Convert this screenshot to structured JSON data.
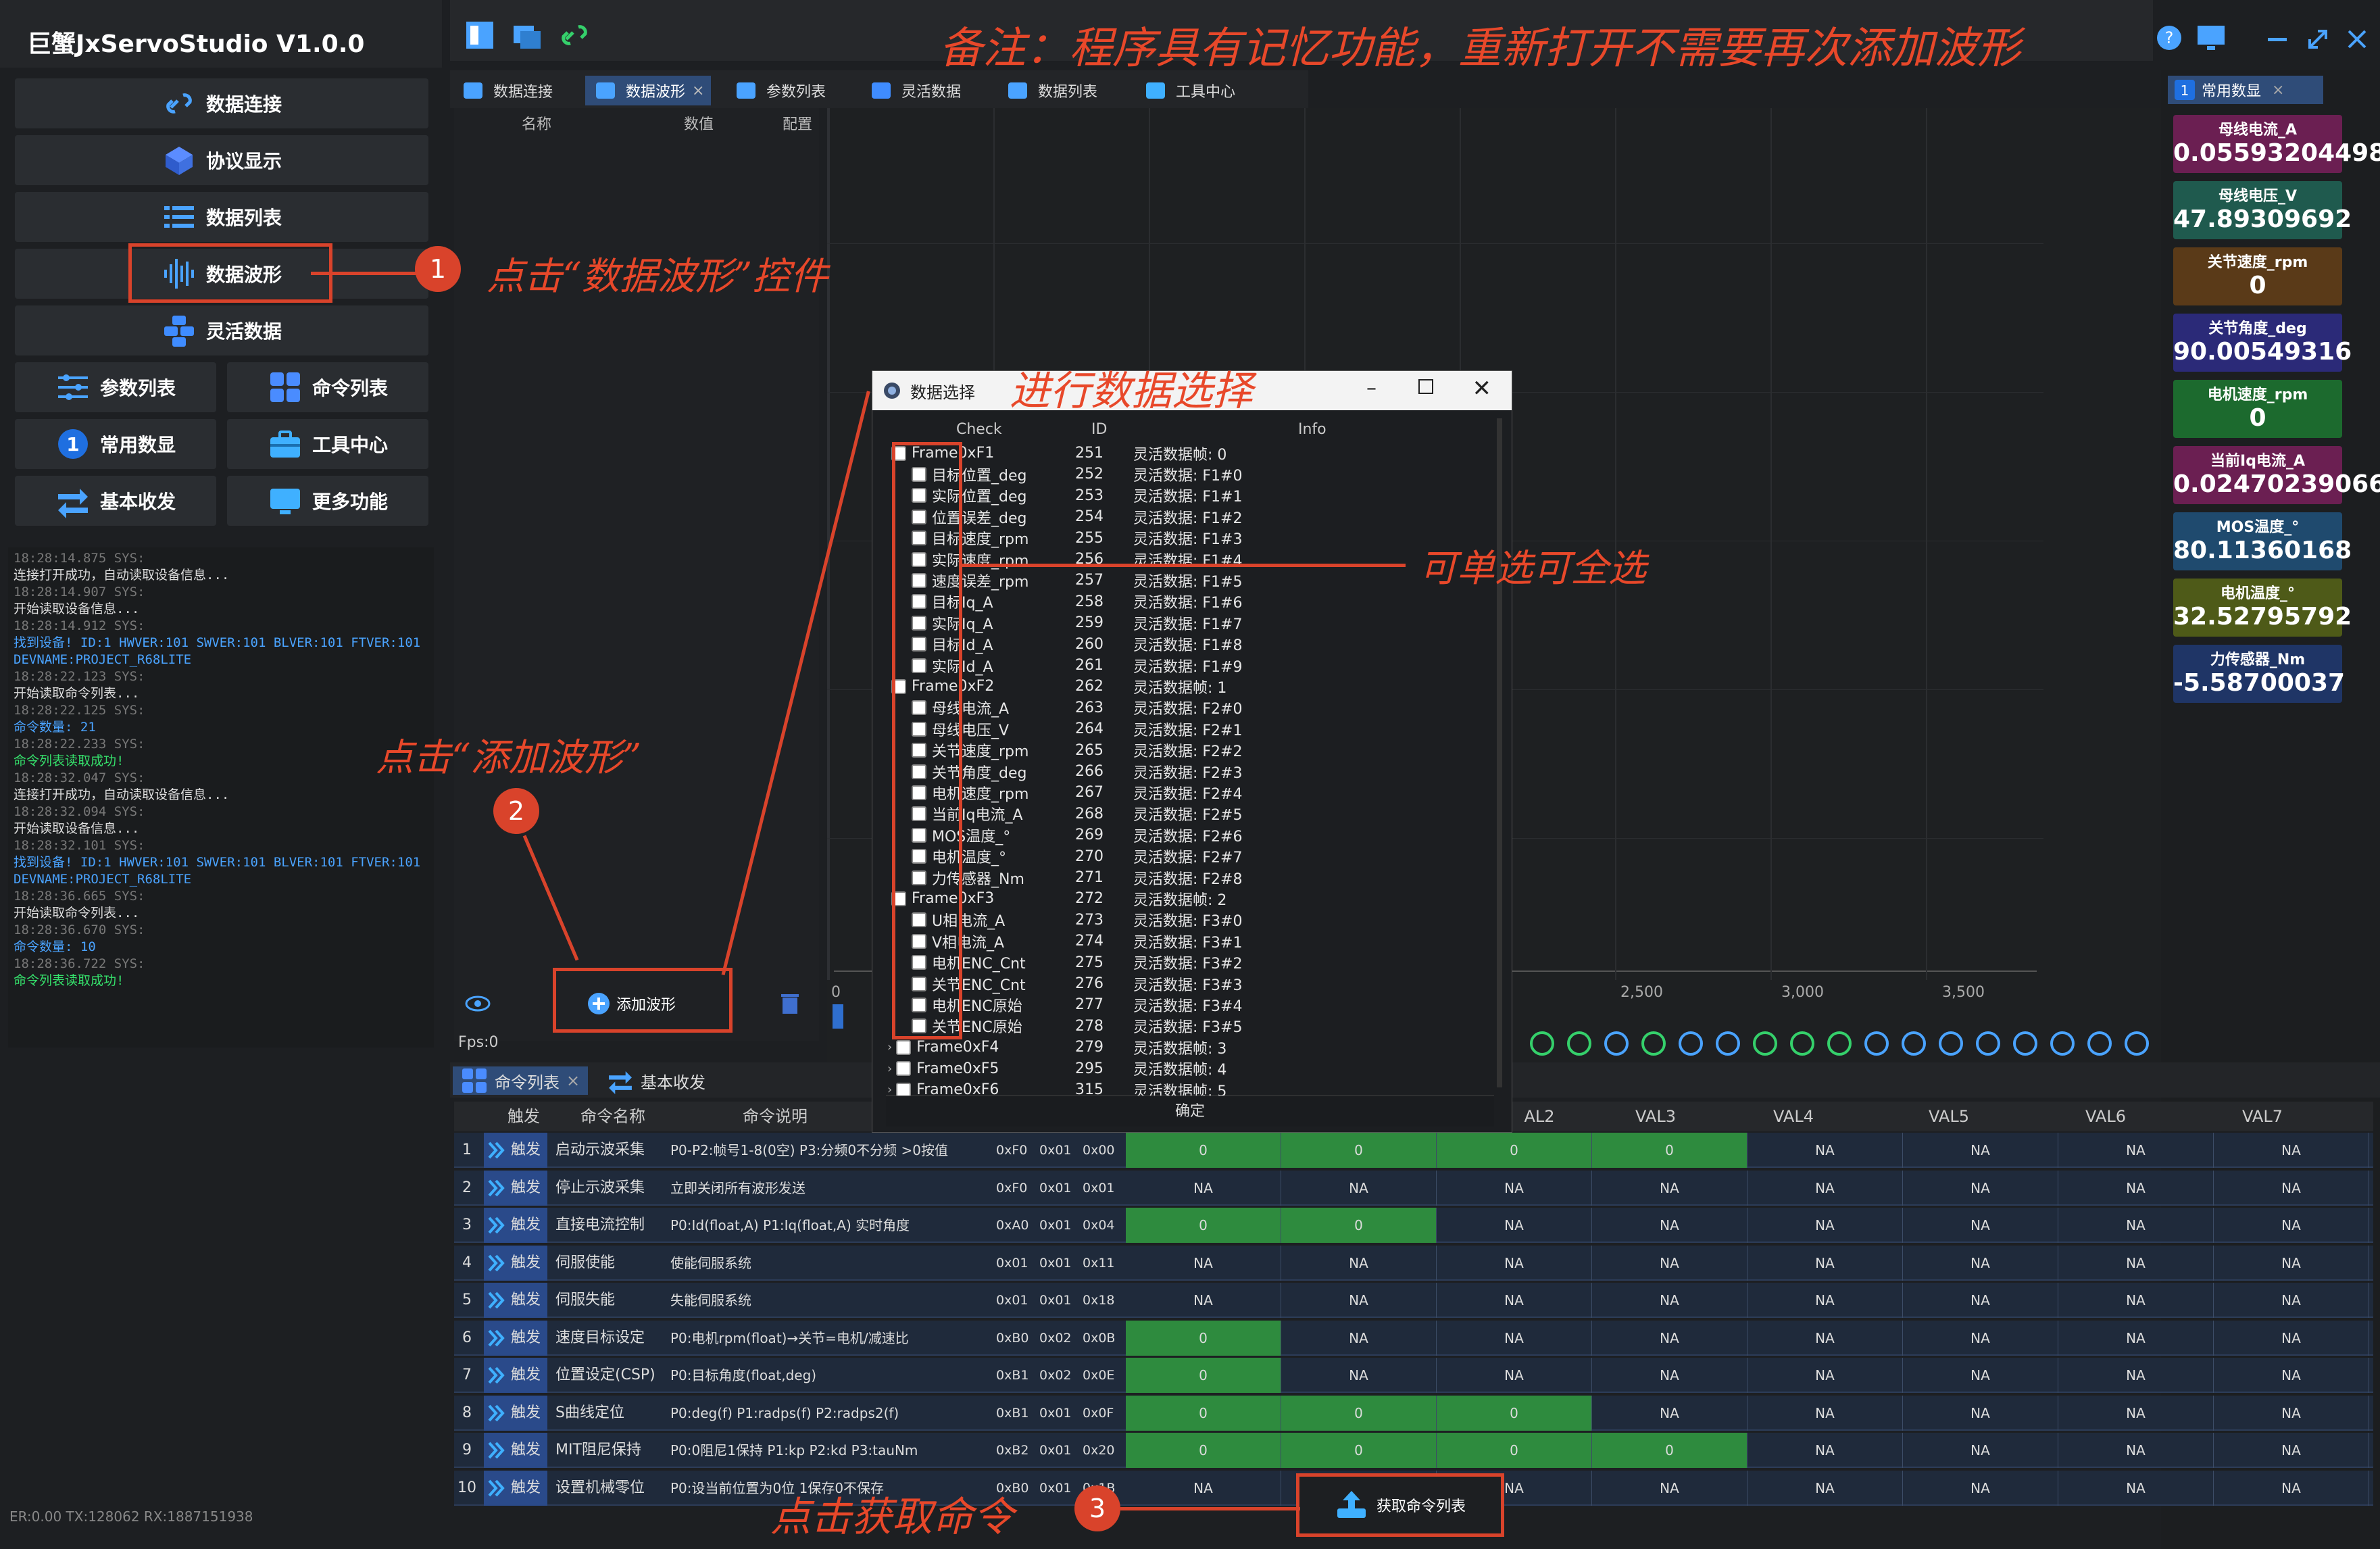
{
  "app": {
    "title": "巨蟹JxServoStudio   V1.0.0"
  },
  "annotations": {
    "note": "备注：程序具有记忆功能，重新打开不需要再次添加波形",
    "step1": "点击“数据波形”控件",
    "step_select": "进行数据选择",
    "step_single_all": "可单选可全选",
    "step2": "点击“添加波形”",
    "step3": "点击获取命令",
    "num1": "1",
    "num2": "2",
    "num3": "3"
  },
  "nav": {
    "connect": "数据连接",
    "protocol": "协议显示",
    "datalist": "数据列表",
    "waveform": "数据波形",
    "flexdata": "灵活数据",
    "params": "参数列表",
    "commands": "命令列表",
    "common": "常用数显",
    "common_badge": "1",
    "toolcenter": "工具中心",
    "basicio": "基本收发",
    "more": "更多功能"
  },
  "log": [
    {
      "t": "18:28:14.875 SYS:",
      "m": "连接打开成功，自动读取设备信息...",
      "c": "w"
    },
    {
      "t": "18:28:14.907 SYS:",
      "m": "开始读取设备信息...",
      "c": "w"
    },
    {
      "t": "18:28:14.912 SYS:",
      "m": "找到设备! ID:1 HWVER:101 SWVER:101 BLVER:101 FTVER:101",
      "c": "b"
    },
    {
      "t": "",
      "m": "DEVNAME:PROJECT_R68LITE",
      "c": "b"
    },
    {
      "t": "18:28:22.123 SYS:",
      "m": "开始读取命令列表...",
      "c": "w"
    },
    {
      "t": "18:28:22.125 SYS:",
      "m": "命令数量: 21",
      "c": "b"
    },
    {
      "t": "18:28:22.233 SYS:",
      "m": "命令列表读取成功!",
      "c": "g"
    },
    {
      "t": "18:28:32.047 SYS:",
      "m": "连接打开成功，自动读取设备信息...",
      "c": "w"
    },
    {
      "t": "18:28:32.094 SYS:",
      "m": "开始读取设备信息...",
      "c": "w"
    },
    {
      "t": "18:28:32.101 SYS:",
      "m": "找到设备! ID:1 HWVER:101 SWVER:101 BLVER:101 FTVER:101",
      "c": "b"
    },
    {
      "t": "",
      "m": "DEVNAME:PROJECT_R68LITE",
      "c": "b"
    },
    {
      "t": "18:28:36.665 SYS:",
      "m": "开始读取命令列表...",
      "c": "w"
    },
    {
      "t": "18:28:36.670 SYS:",
      "m": "命令数量: 10",
      "c": "b"
    },
    {
      "t": "18:28:36.722 SYS:",
      "m": "命令列表读取成功!",
      "c": "g"
    }
  ],
  "status": "ER:0.00 TX:128062 RX:1887151938",
  "tabs": [
    "数据连接",
    "数据波形",
    "参数列表",
    "灵活数据",
    "数据列表",
    "工具中心"
  ],
  "wave_panel": {
    "col_name": "名称",
    "col_value": "数值",
    "col_config": "配置",
    "add_button": "添加波形",
    "fps": "Fps:0"
  },
  "plot": {
    "x_ticks": [
      "0",
      "2,500",
      "3,000",
      "3,500"
    ]
  },
  "right_panel": {
    "tab": "常用数显",
    "tab_badge": "1",
    "cards": [
      {
        "label": "母线电流_A",
        "value": "0.05593204498",
        "color": "#6b1f52"
      },
      {
        "label": "母线电压_V",
        "value": "47.89309692",
        "color": "#1f5a4e"
      },
      {
        "label": "关节速度_rpm",
        "value": "0",
        "color": "#5a3a18"
      },
      {
        "label": "关节角度_deg",
        "value": "90.00549316",
        "color": "#2b2a78"
      },
      {
        "label": "电机速度_rpm",
        "value": "0",
        "color": "#1c6a2e"
      },
      {
        "label": "当前Iq电流_A",
        "value": "0.02470239066",
        "color": "#6b1f52"
      },
      {
        "label": "MOS温度_°",
        "value": "80.11360168",
        "color": "#1f4a6e"
      },
      {
        "label": "电机温度_°",
        "value": "32.52795792",
        "color": "#4e5a18"
      },
      {
        "label": "力传感器_Nm",
        "value": "-5.58700037",
        "color": "#1f3566"
      }
    ]
  },
  "dialog": {
    "title": "数据选择",
    "col_check": "Check",
    "col_id": "ID",
    "col_info": "Info",
    "confirm": "确定",
    "rows": [
      {
        "name": "Frame0xF1",
        "id": "251",
        "info": "灵活数据帧: 0",
        "lvl": 0
      },
      {
        "name": "目标位置_deg",
        "id": "252",
        "info": "灵活数据: F1#0",
        "lvl": 1
      },
      {
        "name": "实际位置_deg",
        "id": "253",
        "info": "灵活数据: F1#1",
        "lvl": 1
      },
      {
        "name": "位置误差_deg",
        "id": "254",
        "info": "灵活数据: F1#2",
        "lvl": 1
      },
      {
        "name": "目标速度_rpm",
        "id": "255",
        "info": "灵活数据: F1#3",
        "lvl": 1
      },
      {
        "name": "实际速度_rpm",
        "id": "256",
        "info": "灵活数据: F1#4",
        "lvl": 1
      },
      {
        "name": "速度误差_rpm",
        "id": "257",
        "info": "灵活数据: F1#5",
        "lvl": 1
      },
      {
        "name": "目标Iq_A",
        "id": "258",
        "info": "灵活数据: F1#6",
        "lvl": 1
      },
      {
        "name": "实际Iq_A",
        "id": "259",
        "info": "灵活数据: F1#7",
        "lvl": 1
      },
      {
        "name": "目标Id_A",
        "id": "260",
        "info": "灵活数据: F1#8",
        "lvl": 1
      },
      {
        "name": "实际Id_A",
        "id": "261",
        "info": "灵活数据: F1#9",
        "lvl": 1
      },
      {
        "name": "Frame0xF2",
        "id": "262",
        "info": "灵活数据帧: 1",
        "lvl": 0
      },
      {
        "name": "母线电流_A",
        "id": "263",
        "info": "灵活数据: F2#0",
        "lvl": 1
      },
      {
        "name": "母线电压_V",
        "id": "264",
        "info": "灵活数据: F2#1",
        "lvl": 1
      },
      {
        "name": "关节速度_rpm",
        "id": "265",
        "info": "灵活数据: F2#2",
        "lvl": 1
      },
      {
        "name": "关节角度_deg",
        "id": "266",
        "info": "灵活数据: F2#3",
        "lvl": 1
      },
      {
        "name": "电机速度_rpm",
        "id": "267",
        "info": "灵活数据: F2#4",
        "lvl": 1
      },
      {
        "name": "当前Iq电流_A",
        "id": "268",
        "info": "灵活数据: F2#5",
        "lvl": 1
      },
      {
        "name": "MOS温度_°",
        "id": "269",
        "info": "灵活数据: F2#6",
        "lvl": 1
      },
      {
        "name": "电机温度_°",
        "id": "270",
        "info": "灵活数据: F2#7",
        "lvl": 1
      },
      {
        "name": "力传感器_Nm",
        "id": "271",
        "info": "灵活数据: F2#8",
        "lvl": 1
      },
      {
        "name": "Frame0xF3",
        "id": "272",
        "info": "灵活数据帧: 2",
        "lvl": 0
      },
      {
        "name": "U相电流_A",
        "id": "273",
        "info": "灵活数据: F3#0",
        "lvl": 1
      },
      {
        "name": "V相电流_A",
        "id": "274",
        "info": "灵活数据: F3#1",
        "lvl": 1
      },
      {
        "name": "电机ENC_Cnt",
        "id": "275",
        "info": "灵活数据: F3#2",
        "lvl": 1
      },
      {
        "name": "关节ENC_Cnt",
        "id": "276",
        "info": "灵活数据: F3#3",
        "lvl": 1
      },
      {
        "name": "电机ENC原始",
        "id": "277",
        "info": "灵活数据: F3#4",
        "lvl": 1
      },
      {
        "name": "关节ENC原始",
        "id": "278",
        "info": "灵活数据: F3#5",
        "lvl": 1
      },
      {
        "name": "Frame0xF4",
        "id": "279",
        "info": "灵活数据帧: 3",
        "lvl": 0
      },
      {
        "name": "Frame0xF5",
        "id": "295",
        "info": "灵活数据帧: 4",
        "lvl": 0
      },
      {
        "name": "Frame0xF6",
        "id": "315",
        "info": "灵活数据帧: 5",
        "lvl": 0
      }
    ]
  },
  "cmd_tabs": [
    "命令列表",
    "基本收发"
  ],
  "cmd_table": {
    "headers": [
      "触发",
      "命令名称",
      "命令说明",
      "AL2",
      "VAL3",
      "VAL4",
      "VAL5",
      "VAL6",
      "VAL7"
    ],
    "trigger_label": "触发",
    "rows": [
      {
        "n": "1",
        "name": "启动示波采集",
        "desc": "P0-P2:帧号1-8(0空) P3:分频0不分频 >0按值",
        "c1": "0xF0",
        "c2": "0x01",
        "c3": "0x00",
        "v": [
          "0",
          "0",
          "0",
          "0",
          "NA",
          "NA",
          "NA",
          "NA"
        ],
        "g": [
          1,
          1,
          1,
          1,
          0,
          0,
          0,
          0
        ]
      },
      {
        "n": "2",
        "name": "停止示波采集",
        "desc": "立即关闭所有波形发送",
        "c1": "0xF0",
        "c2": "0x01",
        "c3": "0x01",
        "v": [
          "NA",
          "NA",
          "NA",
          "NA",
          "NA",
          "NA",
          "NA",
          "NA"
        ],
        "g": [
          0,
          0,
          0,
          0,
          0,
          0,
          0,
          0
        ]
      },
      {
        "n": "3",
        "name": "直接电流控制",
        "desc": "P0:Id(float,A) P1:Iq(float,A) 实时角度",
        "c1": "0xA0",
        "c2": "0x01",
        "c3": "0x04",
        "v": [
          "0",
          "0",
          "NA",
          "NA",
          "NA",
          "NA",
          "NA",
          "NA"
        ],
        "g": [
          1,
          1,
          0,
          0,
          0,
          0,
          0,
          0
        ]
      },
      {
        "n": "4",
        "name": "伺服使能",
        "desc": "使能伺服系统",
        "c1": "0x01",
        "c2": "0x01",
        "c3": "0x11",
        "v": [
          "NA",
          "NA",
          "NA",
          "NA",
          "NA",
          "NA",
          "NA",
          "NA"
        ],
        "g": [
          0,
          0,
          0,
          0,
          0,
          0,
          0,
          0
        ]
      },
      {
        "n": "5",
        "name": "伺服失能",
        "desc": "失能伺服系统",
        "c1": "0x01",
        "c2": "0x01",
        "c3": "0x18",
        "v": [
          "NA",
          "NA",
          "NA",
          "NA",
          "NA",
          "NA",
          "NA",
          "NA"
        ],
        "g": [
          0,
          0,
          0,
          0,
          0,
          0,
          0,
          0
        ]
      },
      {
        "n": "6",
        "name": "速度目标设定",
        "desc": "P0:电机rpm(float)→关节=电机/减速比",
        "c1": "0xB0",
        "c2": "0x02",
        "c3": "0x0B",
        "v": [
          "0",
          "NA",
          "NA",
          "NA",
          "NA",
          "NA",
          "NA",
          "NA"
        ],
        "g": [
          1,
          0,
          0,
          0,
          0,
          0,
          0,
          0
        ]
      },
      {
        "n": "7",
        "name": "位置设定(CSP)",
        "desc": "P0:目标角度(float,deg)",
        "c1": "0xB1",
        "c2": "0x02",
        "c3": "0x0E",
        "v": [
          "0",
          "NA",
          "NA",
          "NA",
          "NA",
          "NA",
          "NA",
          "NA"
        ],
        "g": [
          1,
          0,
          0,
          0,
          0,
          0,
          0,
          0
        ]
      },
      {
        "n": "8",
        "name": "S曲线定位",
        "desc": "P0:deg(f) P1:radps(f) P2:radps2(f)",
        "c1": "0xB1",
        "c2": "0x01",
        "c3": "0x0F",
        "v": [
          "0",
          "0",
          "0",
          "NA",
          "NA",
          "NA",
          "NA",
          "NA"
        ],
        "g": [
          1,
          1,
          1,
          0,
          0,
          0,
          0,
          0
        ]
      },
      {
        "n": "9",
        "name": "MIT阻尼保持",
        "desc": "P0:0阻尼1保持 P1:kp P2:kd P3:tauNm",
        "c1": "0xB2",
        "c2": "0x01",
        "c3": "0x20",
        "v": [
          "0",
          "0",
          "0",
          "0",
          "NA",
          "NA",
          "NA",
          "NA"
        ],
        "g": [
          1,
          1,
          1,
          1,
          0,
          0,
          0,
          0
        ]
      },
      {
        "n": "10",
        "name": "设置机械零位",
        "desc": "P0:设当前位置为0位 1保存0不保存",
        "c1": "0xB0",
        "c2": "0x01",
        "c3": "0x1B",
        "v": [
          "NA",
          "NA",
          "NA",
          "NA",
          "NA",
          "NA",
          "NA",
          "NA"
        ],
        "g": [
          0,
          0,
          0,
          0,
          0,
          0,
          0,
          0
        ]
      }
    ],
    "fetch_button": "获取命令列表"
  }
}
